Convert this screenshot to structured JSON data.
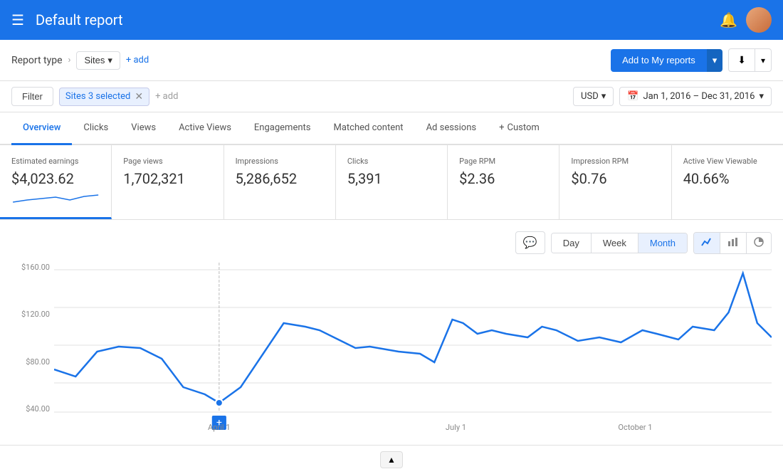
{
  "header": {
    "title": "Default report",
    "hamburger_icon": "☰",
    "bell_icon": "🔔"
  },
  "report_type_bar": {
    "report_type_label": "Report type",
    "breadcrumb_arrow": "›",
    "sites_label": "Sites",
    "dropdown_arrow": "▾",
    "add_label": "+ add",
    "add_reports_btn": "Add to My reports",
    "download_icon": "⬇"
  },
  "filter_bar": {
    "filter_btn_label": "Filter",
    "sites_tag_label": "Sites 3 selected",
    "add_placeholder": "+ add",
    "clear_icon": "✕",
    "currency_label": "USD",
    "currency_arrow": "▾",
    "calendar_icon": "📅",
    "date_range": "Jan 1, 2016 – Dec 31, 2016",
    "date_arrow": "▾"
  },
  "tabs": [
    {
      "label": "Overview",
      "active": true
    },
    {
      "label": "Clicks",
      "active": false
    },
    {
      "label": "Views",
      "active": false
    },
    {
      "label": "Active Views",
      "active": false
    },
    {
      "label": "Engagements",
      "active": false
    },
    {
      "label": "Matched content",
      "active": false
    },
    {
      "label": "Ad sessions",
      "active": false
    },
    {
      "label": "Custom",
      "active": false,
      "prefix": "+"
    }
  ],
  "metrics": [
    {
      "label": "Estimated earnings",
      "value": "$4,023.62",
      "active": true
    },
    {
      "label": "Page views",
      "value": "1,702,321",
      "active": false
    },
    {
      "label": "Impressions",
      "value": "5,286,652",
      "active": false
    },
    {
      "label": "Clicks",
      "value": "5,391",
      "active": false
    },
    {
      "label": "Page RPM",
      "value": "$2.36",
      "active": false
    },
    {
      "label": "Impression RPM",
      "value": "$0.76",
      "active": false
    },
    {
      "label": "Active View Viewable",
      "value": "40.66%",
      "active": false
    }
  ],
  "chart": {
    "comment_icon": "💬",
    "time_buttons": [
      "Day",
      "Week",
      "Month"
    ],
    "active_time": "Month",
    "chart_type_buttons": [
      "line",
      "bar",
      "pie"
    ],
    "y_axis_labels": [
      "$160.00",
      "$120.00",
      "$80.00",
      "$40.00"
    ],
    "x_axis_labels": [
      "April 1",
      "July 1",
      "October 1"
    ]
  },
  "bottom": {
    "scroll_up_icon": "▲"
  }
}
